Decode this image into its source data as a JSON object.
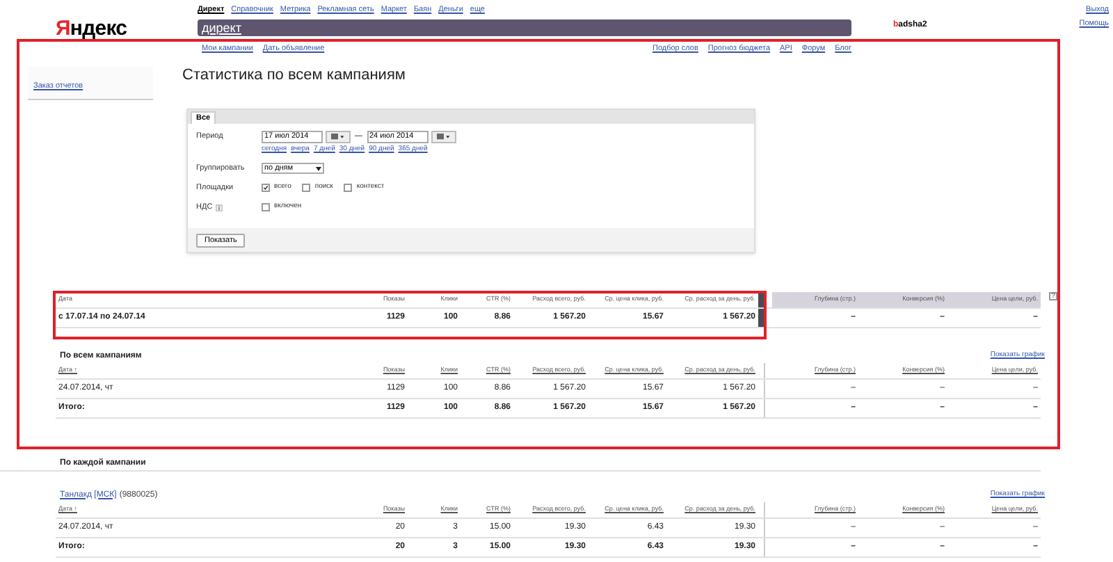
{
  "header": {
    "logo": "Яндекс",
    "services": [
      {
        "label": "Директ",
        "selected": true
      },
      {
        "label": "Справочник",
        "selected": false
      },
      {
        "label": "Метрика",
        "selected": false
      },
      {
        "label": "Рекламная сеть",
        "selected": false
      },
      {
        "label": "Маркет",
        "selected": false
      },
      {
        "label": "Баян",
        "selected": false
      },
      {
        "label": "Деньги",
        "selected": false
      },
      {
        "label": "еще",
        "selected": false
      }
    ],
    "search": {
      "value": "директ"
    },
    "user": "badsha2",
    "links": [
      "Выход",
      "Помощь"
    ]
  },
  "subnav": {
    "left": [
      "Мои кампании",
      "Дать объявление"
    ],
    "right": [
      "Подбор слов",
      "Прогноз бюджета",
      "API",
      "Форум",
      "Блог"
    ]
  },
  "sidebar": {
    "items": [
      "Заказ отчетов"
    ]
  },
  "title": "Статистика по всем кампаниям",
  "filter": {
    "tabs": [
      {
        "label": "Все",
        "selected": true
      }
    ],
    "period": {
      "label": "Период",
      "from": "17 июл 2014",
      "dash": "—",
      "to": "24 июл 2014",
      "quick": [
        "сегодня",
        "вчера",
        "7 дней",
        "30 дней",
        "90 дней",
        "365 дней"
      ]
    },
    "group": {
      "label": "Группировать",
      "value": "по дням"
    },
    "platforms": {
      "label": "Площадки",
      "options": [
        {
          "label": "всего",
          "checked": true
        },
        {
          "label": "поиск",
          "checked": false
        },
        {
          "label": "контекст",
          "checked": false
        }
      ]
    },
    "vat": {
      "label": "НДС",
      "options": [
        {
          "label": "включен",
          "checked": false
        }
      ]
    },
    "submit": "Показать"
  },
  "summary": {
    "columns": [
      "Дата",
      "Показы",
      "Клики",
      "CTR (%)",
      "Расход всего, руб.",
      "Ср. цена клика, руб.",
      "Ср. расход за день, руб.",
      "Глубина (стр.)",
      "Конверсия (%)",
      "Цена цели, руб."
    ],
    "help": "?",
    "row": [
      "с 17.07.14 по 24.07.14",
      "1129",
      "100",
      "8.86",
      "1 567.20",
      "15.67",
      "1 567.20",
      "–",
      "–",
      "–"
    ]
  },
  "all_campaigns": {
    "title": "По всем кампаниям",
    "chart_link": "Показать график",
    "columns": [
      "Дата ↑",
      "Показы",
      "Клики",
      "CTR (%)",
      "Расход всего, руб.",
      "Ср. цена клика, руб.",
      "Ср. расход за день, руб.",
      "Глубина (стр.)",
      "Конверсия (%)",
      "Цена цели, руб."
    ],
    "rows": [
      {
        "total": false,
        "cells": [
          "24.07.2014, чт",
          "1129",
          "100",
          "8.86",
          "1 567.20",
          "15.67",
          "1 567.20",
          "–",
          "–",
          "–"
        ]
      },
      {
        "total": true,
        "cells": [
          "Итого:",
          "1129",
          "100",
          "8.86",
          "1 567.20",
          "15.67",
          "1 567.20",
          "–",
          "–",
          "–"
        ]
      }
    ]
  },
  "per_campaign": {
    "title": "По каждой кампании",
    "campaigns": [
      {
        "name": "Танлакд [МСК]",
        "id": "(9880025)",
        "chart_link": "Показать график",
        "columns": [
          "Дата ↑",
          "Показы",
          "Клики",
          "CTR (%)",
          "Расход всего, руб.",
          "Ср. цена клика, руб.",
          "Ср. расход за день, руб.",
          "Глубина (стр.)",
          "Конверсия (%)",
          "Цена цели, руб."
        ],
        "rows": [
          {
            "total": false,
            "cells": [
              "24.07.2014, чт",
              "20",
              "3",
              "15.00",
              "19.30",
              "6.43",
              "19.30",
              "–",
              "–",
              "–"
            ]
          },
          {
            "total": true,
            "cells": [
              "Итого:",
              "20",
              "3",
              "15.00",
              "19.30",
              "6.43",
              "19.30",
              "–",
              "–",
              "–"
            ]
          }
        ]
      }
    ]
  }
}
